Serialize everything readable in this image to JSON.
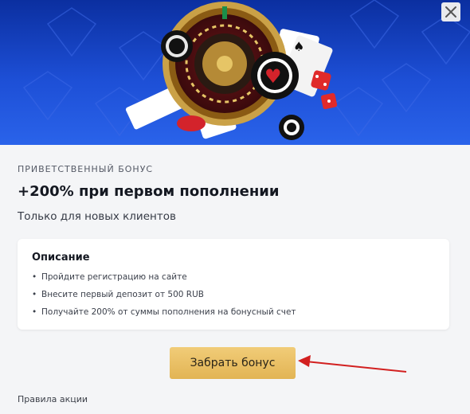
{
  "modal": {
    "eyebrow": "ПРИВЕТСТВЕННЫЙ БОНУС",
    "title": "+200% при первом пополнении",
    "subtitle": "Только для новых клиентов",
    "description": {
      "title": "Описание",
      "items": [
        "Пройдите регистрацию на сайте",
        "Внесите первый депозит от 500 RUB",
        "Получайте 200% от суммы пополнения на бонусный счет"
      ]
    },
    "claim_button_label": "Забрать бонус",
    "rules_link": "Правила акции",
    "close_icon": "close-icon"
  },
  "colors": {
    "banner": "#1d4fd6",
    "button": "#e8bd5e",
    "annotation_arrow": "#d22020"
  }
}
